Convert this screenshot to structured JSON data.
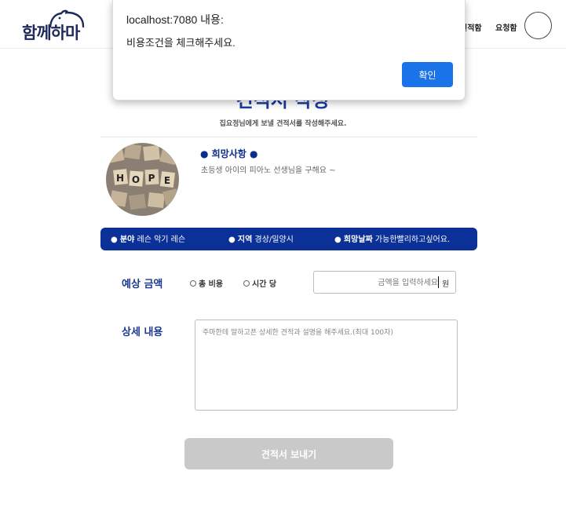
{
  "header": {
    "logo_text": "함께하마",
    "nav": [
      {
        "label": "견적함"
      },
      {
        "label": "요청함"
      }
    ]
  },
  "page": {
    "title": "견적서 작성",
    "subtitle": "집요정님에게 보낼 견적서를 작성해주세요."
  },
  "request": {
    "photo_text": "HOPE",
    "title": "희망사항",
    "title_dot": "●",
    "description": "초등생 아이의 피아노 선생님을 구해요 ~",
    "info": [
      {
        "bullet": "●",
        "key": "분야",
        "value": "레슨 악기 레슨"
      },
      {
        "bullet": "●",
        "key": "지역",
        "value": "경상/밀양시"
      },
      {
        "bullet": "●",
        "key": "희망날짜",
        "value": "가능한빨리하고싶어요."
      }
    ]
  },
  "form": {
    "amount": {
      "label": "예상 금액",
      "options": [
        {
          "label": "총 비용",
          "checked": false
        },
        {
          "label": "시간 당",
          "checked": false
        }
      ],
      "value": "",
      "placeholder": "금액을 입력하세요",
      "unit": "원"
    },
    "detail": {
      "label": "상세 내용",
      "value": "",
      "placeholder": "주마한테 말하고픈 상세한 견적과 설명을 해주세요.(최대 100자)"
    },
    "submit_label": "견적서 보내기",
    "submit_disabled": true
  },
  "dialog": {
    "origin": "localhost:7080 내용:",
    "message": "비용조건을 체크해주세요.",
    "ok_label": "확인"
  },
  "colors": {
    "brand_navy": "#1e2a5a",
    "accent_blue": "#0b3199",
    "dialog_button": "#1a73e8",
    "disabled_button": "#c9c9c9"
  }
}
